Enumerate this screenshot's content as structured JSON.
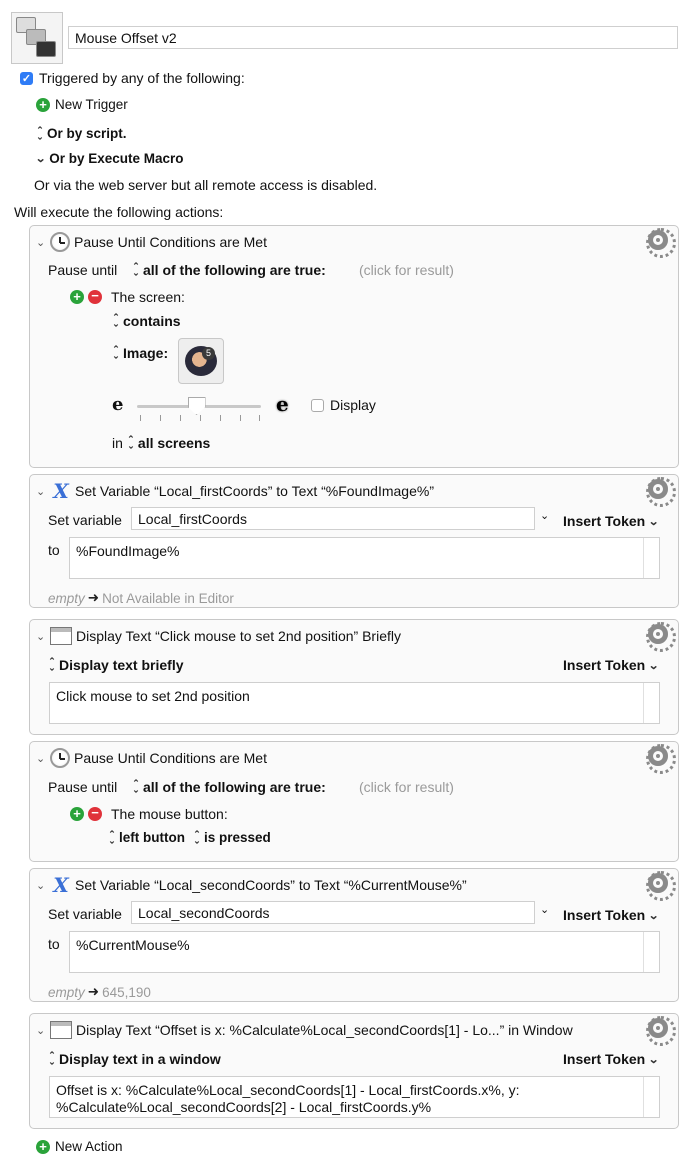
{
  "macro": {
    "name": "Mouse Offset v2",
    "triggered_label": "Triggered by any of the following:",
    "new_trigger": "New Trigger",
    "or_by_script": "Or by script.",
    "or_by_execute_macro": "Or by Execute Macro",
    "web_server_note": "Or via the web server but all remote access is disabled.",
    "will_execute": "Will execute the following actions:",
    "new_action": "New Action"
  },
  "actions": [
    {
      "title": "Pause Until Conditions are Met",
      "pause_until": "Pause until",
      "condition_mode": "all of the following are true:",
      "click_for_result": "(click for result)",
      "condition_label": "The screen:",
      "contains": "contains",
      "image_label": "Image:",
      "thumb_badge": "5",
      "fuzz_low": "e",
      "fuzz_high": "e",
      "fuzz_level": 0.48,
      "display_label": "Display",
      "in_label": "in",
      "screens": "all screens"
    },
    {
      "title": "Set Variable “Local_firstCoords” to Text “%FoundImage%”",
      "set_variable_label": "Set variable",
      "variable": "Local_firstCoords",
      "insert_token": "Insert Token",
      "to_label": "to",
      "text": "%FoundImage%",
      "empty_label": "empty",
      "result": "Not Available in Editor"
    },
    {
      "title": "Display Text “Click mouse to set 2nd position” Briefly",
      "mode": "Display text briefly",
      "insert_token": "Insert Token",
      "text": "Click mouse to set 2nd position"
    },
    {
      "title": "Pause Until Conditions are Met",
      "pause_until": "Pause until",
      "condition_mode": "all of the following are true:",
      "click_for_result": "(click for result)",
      "condition_label": "The mouse button:",
      "button": "left button",
      "state": "is pressed"
    },
    {
      "title": "Set Variable “Local_secondCoords” to Text “%CurrentMouse%”",
      "set_variable_label": "Set variable",
      "variable": "Local_secondCoords",
      "insert_token": "Insert Token",
      "to_label": "to",
      "text": "%CurrentMouse%",
      "empty_label": "empty",
      "result": "645,190"
    },
    {
      "title": "Display Text “Offset is x: %Calculate%Local_secondCoords[1] - Lo...” in Window",
      "mode": "Display text in a window",
      "insert_token": "Insert Token",
      "text_line1": "Offset is x: %Calculate%Local_secondCoords[1] - Local_firstCoords.x%, y:",
      "text_line2": "%Calculate%Local_secondCoords[2] - Local_firstCoords.y%"
    }
  ],
  "colors": {
    "accent": "#2f7cf6",
    "add_green": "#2aa33a",
    "remove_red": "#e0323a",
    "variable_icon": "#3a6fd6"
  }
}
